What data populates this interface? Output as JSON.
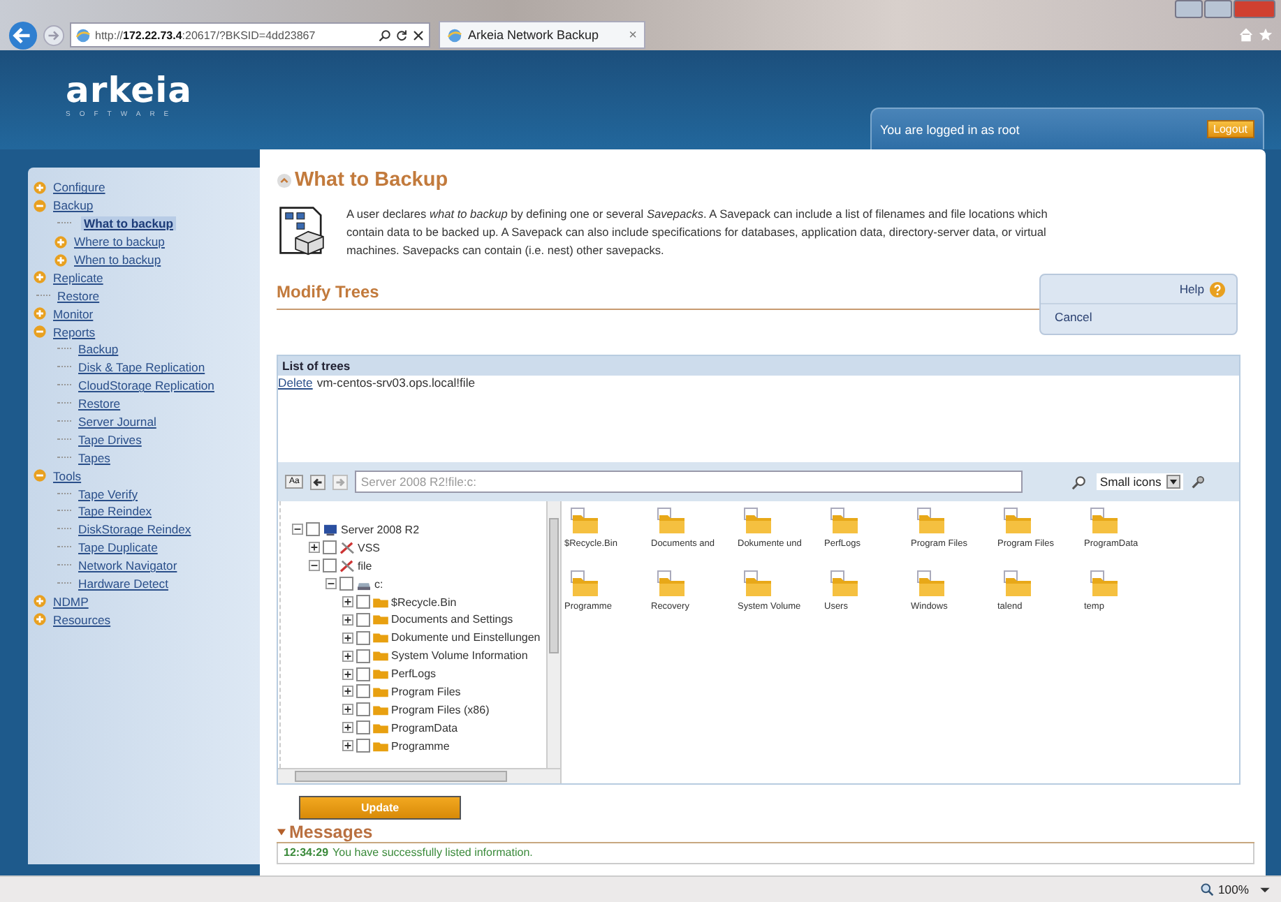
{
  "browser": {
    "url": "http://**172.22.73.4**:20617/?BKSID=4dd23867",
    "tab_title": "Arkeia Network Backup",
    "tab_close": "×",
    "zoom": "100%"
  },
  "header": {
    "logo": "arkeia",
    "logo_sub": "SOFTWARE",
    "login_text": "You are logged in as root",
    "logout": "Logout"
  },
  "sidebar": {
    "items": [
      {
        "label": "Configure",
        "kind": "group",
        "expanded": false,
        "selected": false
      },
      {
        "label": "Backup",
        "kind": "group",
        "expanded": true,
        "selected": false,
        "children": [
          {
            "label": "What to backup",
            "kind": "leaf",
            "selected": true
          },
          {
            "label": "Where to backup",
            "kind": "group",
            "expanded": false,
            "selected": false
          },
          {
            "label": "When to backup",
            "kind": "group",
            "expanded": false,
            "selected": false
          }
        ]
      },
      {
        "label": "Replicate",
        "kind": "group",
        "expanded": false,
        "selected": false
      },
      {
        "label": "Restore",
        "kind": "leaf",
        "selected": false
      },
      {
        "label": "Monitor",
        "kind": "group",
        "expanded": false,
        "selected": false
      },
      {
        "label": "Reports",
        "kind": "group",
        "expanded": true,
        "selected": false,
        "children": [
          {
            "label": "Backup",
            "kind": "leaf",
            "selected": false
          },
          {
            "label": "Disk & Tape Replication",
            "kind": "leaf",
            "selected": false
          },
          {
            "label": "CloudStorage Replication",
            "kind": "leaf",
            "selected": false
          },
          {
            "label": "Restore",
            "kind": "leaf",
            "selected": false
          },
          {
            "label": "Server Journal",
            "kind": "leaf",
            "selected": false
          },
          {
            "label": "Tape Drives",
            "kind": "leaf",
            "selected": false
          },
          {
            "label": "Tapes",
            "kind": "leaf",
            "selected": false
          }
        ]
      },
      {
        "label": "Tools",
        "kind": "group",
        "expanded": true,
        "selected": false,
        "children": [
          {
            "label": "Tape Verify",
            "kind": "leaf",
            "selected": false
          },
          {
            "label": "Tape Reindex",
            "kind": "leaf",
            "selected": false
          },
          {
            "label": "DiskStorage Reindex",
            "kind": "leaf",
            "selected": false
          },
          {
            "label": "Tape Duplicate",
            "kind": "leaf",
            "selected": false
          },
          {
            "label": "Network Navigator",
            "kind": "leaf",
            "selected": false
          },
          {
            "label": "Hardware Detect",
            "kind": "leaf",
            "selected": false
          }
        ]
      },
      {
        "label": "NDMP",
        "kind": "group",
        "expanded": false,
        "selected": false
      },
      {
        "label": "Resources",
        "kind": "group",
        "expanded": false,
        "selected": false
      }
    ]
  },
  "page": {
    "title": "What to Backup",
    "description": "A user declares *what to backup* by defining one or several *Savepacks*. A Savepack can include a list of filenames and file locations which contain data to be backed up. A Savepack can also include specifications for databases, application data, directory-server data, or virtual machines. Savepacks can contain (i.e. nest) other savepacks.",
    "section": "Modify Trees"
  },
  "help_panel": {
    "help": "Help",
    "cancel": "Cancel"
  },
  "trees_list": {
    "title": "List of trees",
    "rows": [
      {
        "action": "Delete",
        "name": "vm-centos-srv03.ops.local!file"
      }
    ]
  },
  "browser_toolbar": {
    "font_button": "Aa",
    "path": "Server 2008 R2!file:c:",
    "view": "Small icons"
  },
  "tree": [
    {
      "label": "Server 2008 R2",
      "kind": "server",
      "checked": false,
      "expanded": true,
      "children": [
        {
          "label": "VSS",
          "kind": "share",
          "checked": false,
          "expanded": false
        },
        {
          "label": "file",
          "kind": "share",
          "checked": false,
          "expanded": true,
          "children": [
            {
              "label": "c:",
              "kind": "drive",
              "checked": false,
              "expanded": true,
              "children": [
                {
                  "label": "$Recycle.Bin",
                  "kind": "folder",
                  "checked": false,
                  "expanded": false
                },
                {
                  "label": "Documents and Settings",
                  "kind": "folder",
                  "checked": false,
                  "expanded": false
                },
                {
                  "label": "Dokumente und Einstellungen",
                  "kind": "folder",
                  "checked": false,
                  "expanded": false
                },
                {
                  "label": "System Volume Information",
                  "kind": "folder",
                  "checked": false,
                  "expanded": false
                },
                {
                  "label": "PerfLogs",
                  "kind": "folder",
                  "checked": false,
                  "expanded": false
                },
                {
                  "label": "Program Files",
                  "kind": "folder",
                  "checked": false,
                  "expanded": false
                },
                {
                  "label": "Program Files (x86)",
                  "kind": "folder",
                  "checked": false,
                  "expanded": false
                },
                {
                  "label": "ProgramData",
                  "kind": "folder",
                  "checked": false,
                  "expanded": false
                },
                {
                  "label": "Programme",
                  "kind": "folder",
                  "checked": false,
                  "expanded": false
                }
              ]
            }
          ]
        }
      ]
    }
  ],
  "grid": [
    {
      "label": "$Recycle.Bin"
    },
    {
      "label": "Documents and"
    },
    {
      "label": "Dokumente und"
    },
    {
      "label": "PerfLogs"
    },
    {
      "label": "Program Files"
    },
    {
      "label": "Program Files"
    },
    {
      "label": "ProgramData"
    },
    {
      "label": "Programme"
    },
    {
      "label": "Recovery"
    },
    {
      "label": "System Volume"
    },
    {
      "label": "Users"
    },
    {
      "label": "Windows"
    },
    {
      "label": "talend"
    },
    {
      "label": "temp"
    }
  ],
  "update_button": "Update",
  "messages": {
    "title": "Messages",
    "lines": [
      {
        "time": "12:34:29",
        "text": "You have successfully listed information."
      }
    ]
  }
}
